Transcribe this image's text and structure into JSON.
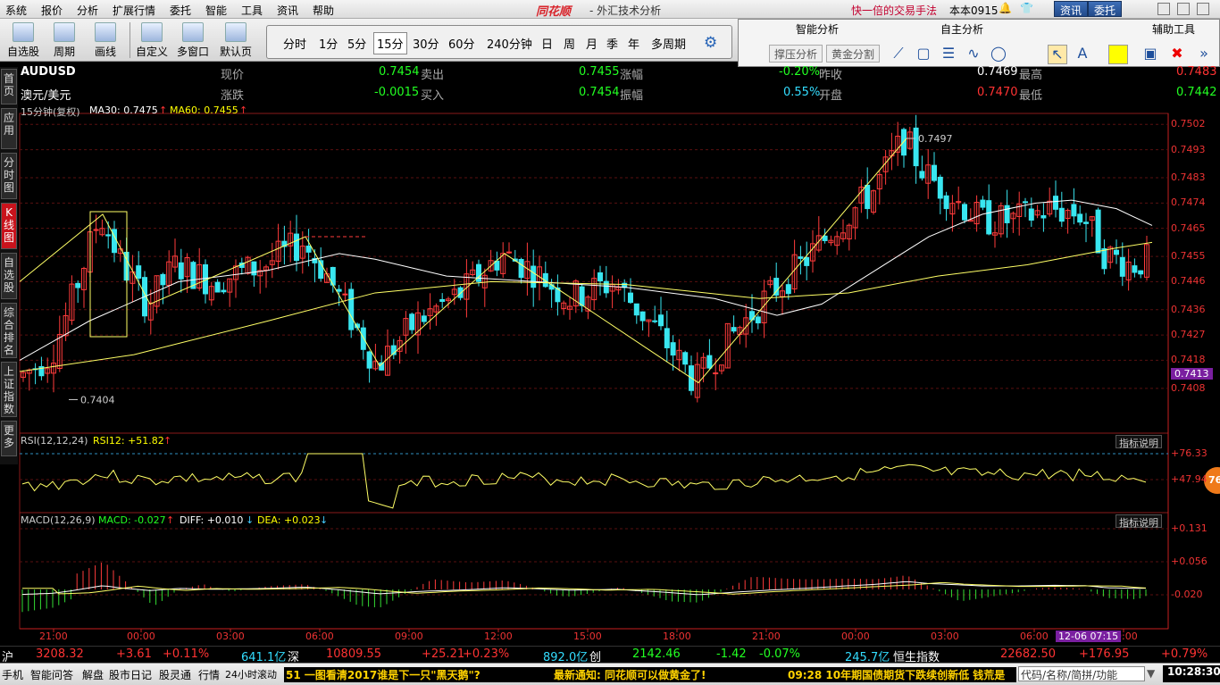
{
  "menu": [
    "系统",
    "报价",
    "分析",
    "扩展行情",
    "委托",
    "智能",
    "工具",
    "资讯",
    "帮助"
  ],
  "brand": "同花顺",
  "app_title": "- 外汇技术分析",
  "promo": "快一倍的交易手法",
  "account": "本本0915",
  "top_buttons": {
    "news": "资讯",
    "trade": "委托"
  },
  "toolbar": {
    "items": [
      "自选股",
      "周期",
      "画线",
      "自定义",
      "多窗口",
      "默认页"
    ]
  },
  "periods": {
    "items": [
      "分时",
      "1分",
      "5分",
      "15分",
      "30分",
      "60分",
      "240分钟",
      "日",
      "周",
      "月",
      "季",
      "年",
      "多周期"
    ],
    "selected": "15分",
    "gear": "gear-icon"
  },
  "right_panel": {
    "smart": "智能分析",
    "independent": "自主分析",
    "assist": "辅助工具",
    "btn1": "撑压分析",
    "btn2": "黄金分割",
    "colors": {
      "accent_yellow": "#ffff00",
      "red": "#ff0000"
    }
  },
  "left_tabs": [
    "首页",
    "应用",
    "分时图",
    "K线图",
    "自选股",
    "综合排名",
    "上证指数",
    "更多"
  ],
  "quote": {
    "code": "AUDUSD",
    "name": "澳元/美元",
    "l_price": "现价",
    "price": "0.7454",
    "l_sell": "卖出",
    "sell": "0.7455",
    "l_chg": "涨幅",
    "chg_pct": "-0.20%",
    "l_prev": "昨收",
    "prev": "0.7469",
    "l_high": "最高",
    "high": "0.7483",
    "l_change": "涨跌",
    "change": "-0.0015",
    "l_buy": "买入",
    "buy": "0.7454",
    "l_amp": "振幅",
    "amp": "0.55%",
    "l_open": "开盘",
    "open": "0.7470",
    "l_low": "最低",
    "low": "0.7442"
  },
  "main_indicator": {
    "label": "15分钟(复权)",
    "ma30": "MA30: 0.7475",
    "ma60": "MA60: 0.7455",
    "arrow_up": "↑"
  },
  "rsi": {
    "label": "RSI(12,12,24)",
    "val": "RSI12: +51.82",
    "help": "指标说明",
    "badge": "76"
  },
  "macd": {
    "label": "MACD(12,26,9)",
    "macd": "MACD: -0.027",
    "diff": "DIFF: +0.010",
    "dea": "DEA: +0.023",
    "help": "指标说明"
  },
  "price_axis": [
    "0.7502",
    "0.7493",
    "0.7483",
    "0.7474",
    "0.7465",
    "0.7455",
    "0.7446",
    "0.7436",
    "0.7427",
    "0.7418",
    "0.7413",
    "0.7408"
  ],
  "rsi_axis": [
    "+76.33",
    "+47.94"
  ],
  "macd_axis": [
    "+0.131",
    "+0.056",
    "-0.020"
  ],
  "time_axis": [
    "21:00",
    "00:00",
    "03:00",
    "06:00",
    "09:00",
    "12:00",
    "15:00",
    "18:00",
    "21:00",
    "00:00",
    "03:00",
    "06:00",
    "09:00"
  ],
  "time_cursor": "12-06 07:15",
  "annot": {
    "high": "0.7497",
    "low": "0.7404"
  },
  "chart_data": {
    "type": "candlestick",
    "y_range": [
      0.74,
      0.7504
    ],
    "markers": {
      "high": 0.7497,
      "low": 0.7404
    },
    "current": 0.7413
  },
  "ticker": {
    "sh": "沪",
    "sh_idx": "3208.32",
    "sh_chg": "+3.61",
    "sh_pct": "+0.11%",
    "sh_vol": "641.1亿",
    "sz": "深",
    "sz_idx": "10809.55",
    "sz_chg": "+25.21",
    "sz_pct": "+0.23%",
    "sz_vol": "892.0亿",
    "cy": "创",
    "cy_idx": "2142.46",
    "cy_chg": "-1.42",
    "cy_pct": "-0.07%",
    "cy_vol": "245.7亿",
    "hs": "恒生指数",
    "hs_idx": "22682.50",
    "hs_chg": "+176.95",
    "hs_pct": "+0.79%"
  },
  "statusbar": {
    "items": [
      "手机",
      "智能问答",
      "解盘",
      "股市日记",
      "股灵通",
      "行情",
      "24小时滚动"
    ],
    "news1": "51 一图看清2017谁是下一只\"黑天鹅\"?",
    "notice": "最新通知: 同花顺可以做黄金了!",
    "news2": "09:28 10年期国债期货下跌续创新低 钱荒是",
    "search": "代码/名称/简拼/功能",
    "clock": "10:28:30"
  }
}
